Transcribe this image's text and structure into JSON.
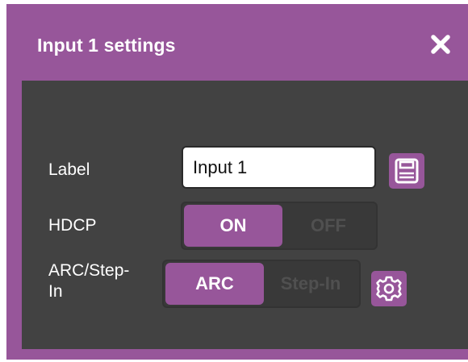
{
  "dialog": {
    "title": "Input 1 settings",
    "close_icon": "close-icon"
  },
  "fields": {
    "label": {
      "label": "Label",
      "value": "Input 1",
      "save_icon": "save-icon"
    },
    "hdcp": {
      "label": "HDCP",
      "on_label": "ON",
      "off_label": "OFF",
      "selected": "ON"
    },
    "arc": {
      "label_line1": "ARC/Step-",
      "label_line2": "In",
      "arc_label": "ARC",
      "stepin_label": "Step-In",
      "selected": "ARC",
      "settings_icon": "gear-icon"
    }
  },
  "colors": {
    "accent": "#97569a",
    "panel": "#424242",
    "toggle_track": "#393939",
    "inactive_text": "#505050"
  }
}
